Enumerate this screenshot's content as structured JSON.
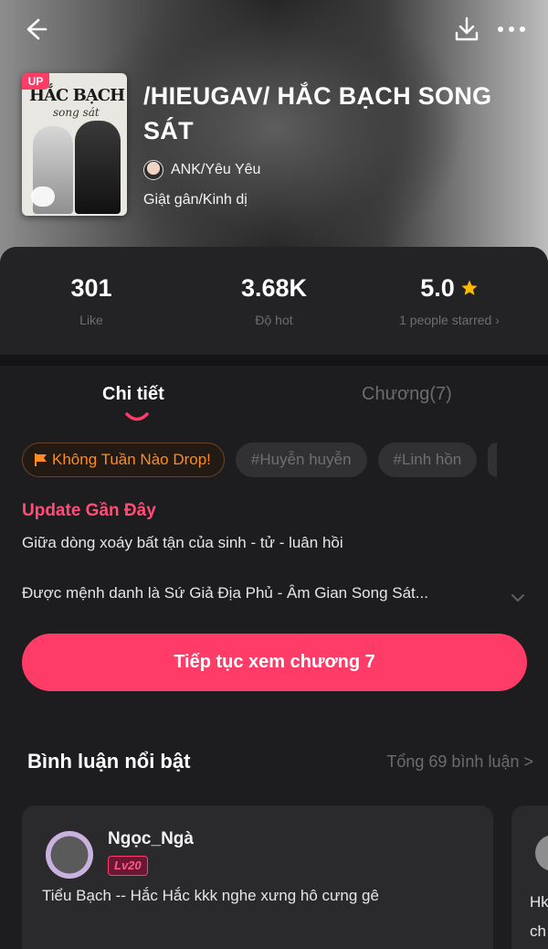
{
  "header": {
    "back_icon": "arrow-left-icon",
    "download_icon": "download-icon",
    "more_icon": "more-horizontal-icon"
  },
  "book": {
    "cover_badge": "UP",
    "cover_title": "HẮC BẠCH",
    "cover_subtitle": "song sát",
    "title": "/HIEUGAV/ HẮC BẠCH SONG SÁT",
    "author": "ANK/Yêu Yêu",
    "genre": "Giật gân/Kinh dị"
  },
  "stats": [
    {
      "value": "301",
      "label": "Like"
    },
    {
      "value": "3.68K",
      "label": "Độ hot"
    },
    {
      "value": "5.0",
      "label": "1 people starred ›"
    }
  ],
  "colors": {
    "accent": "#ff3b68",
    "star": "#ffb800",
    "tag_hot": "#ff8a1e"
  },
  "tabs": {
    "detail": "Chi tiết",
    "chapters": "Chương(7)"
  },
  "tags": [
    "Không Tuần Nào Drop!",
    "#Huyễn huyễn",
    "#Linh hồn"
  ],
  "update": {
    "heading": "Update Gần Đây",
    "line1": "Giữa dòng xoáy bất tận của sinh - tử - luân hồi",
    "line2": "Được mệnh danh là Sứ Giả Địa Phủ - Âm Gian Song Sát..."
  },
  "cta": "Tiếp tục xem chương 7",
  "comments": {
    "title": "Bình luận nổi bật",
    "total": "Tổng 69 bình luận >",
    "items": [
      {
        "user": "Ngọc_Ngà",
        "level": "Lv20",
        "text": "Tiểu Bạch -- Hắc Hắc kkk nghe xưng hô cưng gê"
      }
    ],
    "peek_text": "Hk\nch"
  }
}
